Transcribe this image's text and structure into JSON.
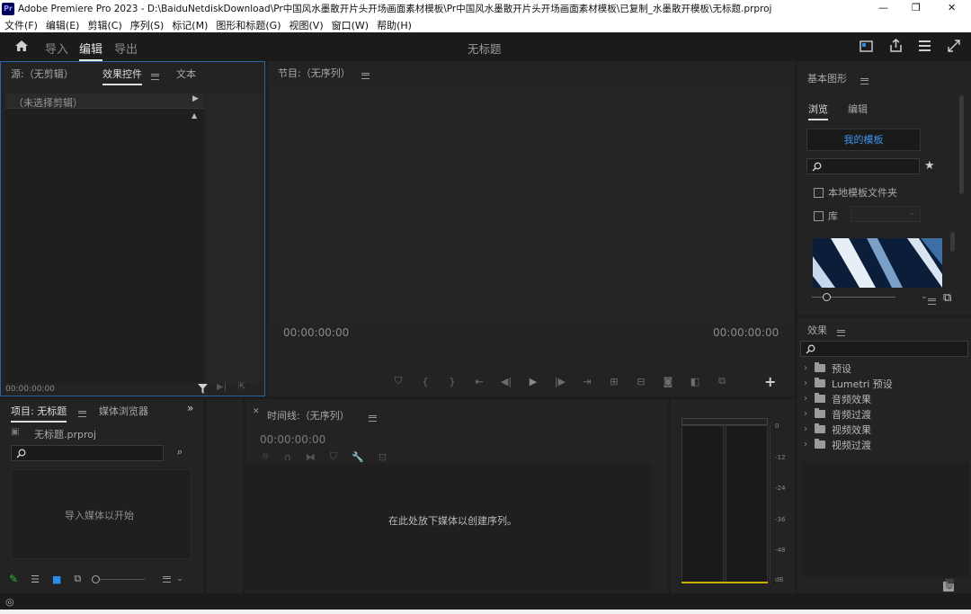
{
  "window": {
    "app_icon": "Pr",
    "title": "Adobe Premiere Pro 2023 - D:\\BaiduNetdiskDownload\\Pr中国风水墨散开片头开场画面素材模板\\Pr中国风水墨散开片头开场画面素材模板\\已复制_水墨散开模板\\无标题.prproj",
    "min": "—",
    "max": "❐",
    "close": "✕"
  },
  "menu": [
    "文件(F)",
    "编辑(E)",
    "剪辑(C)",
    "序列(S)",
    "标记(M)",
    "图形和标题(G)",
    "视图(V)",
    "窗口(W)",
    "帮助(H)"
  ],
  "workspace": {
    "tabs": [
      "导入",
      "编辑",
      "导出"
    ],
    "active": "编辑",
    "title": "无标题"
  },
  "source": {
    "tabs": [
      "源:（无剪辑）",
      "效果控件",
      "文本"
    ],
    "no_clip": "（未选择剪辑）",
    "timecode": "00:00:00:00"
  },
  "program": {
    "title": "节目:（无序列）",
    "tc_left": "00:00:00:00",
    "tc_right": "00:00:00:00"
  },
  "essential": {
    "title": "基本图形",
    "tabs": [
      "浏览",
      "编辑"
    ],
    "my_templates": "我的模板",
    "local_folder": "本地模板文件夹",
    "library": "库"
  },
  "effects": {
    "title": "效果",
    "items": [
      "预设",
      "Lumetri 预设",
      "音频效果",
      "音频过渡",
      "视频效果",
      "视频过渡"
    ]
  },
  "project": {
    "tabs": [
      "项目: 无标题",
      "媒体浏览器"
    ],
    "file": "无标题.prproj",
    "import_hint": "导入媒体以开始"
  },
  "timeline": {
    "title": "时间线:（无序列）",
    "timecode": "00:00:00:00",
    "drop_hint": "在此处放下媒体以创建序列。"
  },
  "meter": {
    "ticks": [
      "0",
      "-12",
      "-24",
      "-36",
      "-48",
      "dB"
    ]
  },
  "colors": {
    "accent": "#2d8ceb",
    "panel": "#232323",
    "bg": "#1d1d1d",
    "meter": "#c7b400"
  }
}
